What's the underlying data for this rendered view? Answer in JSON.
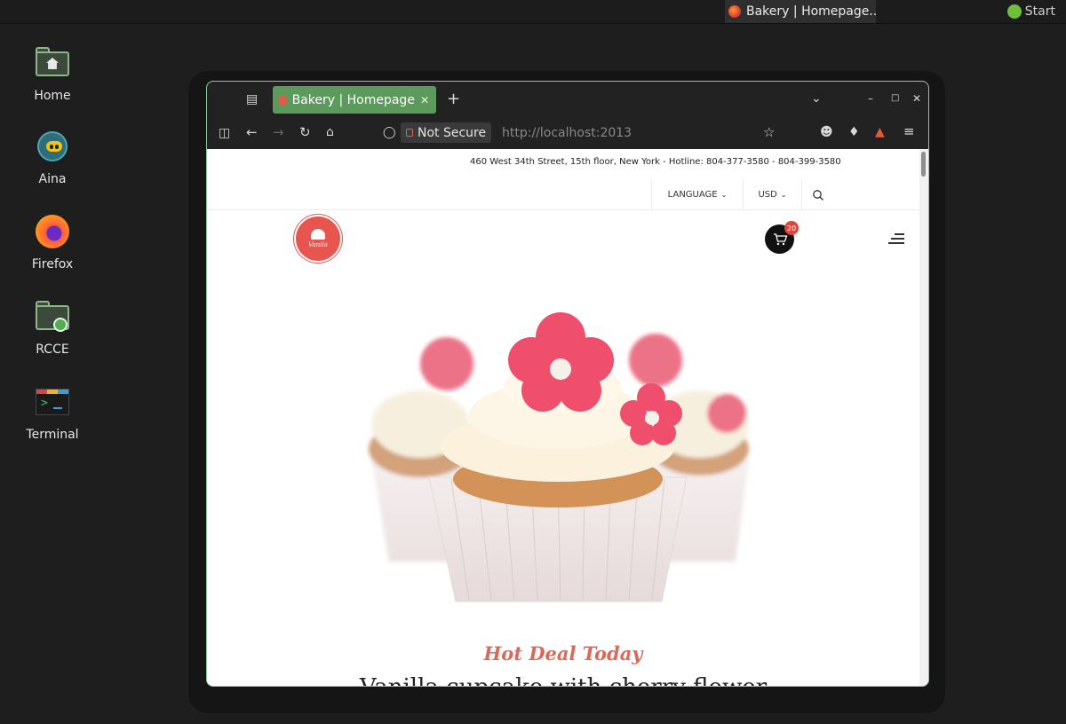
{
  "panel": {
    "task_title": "Bakery | Homepage...",
    "start_label": "Start"
  },
  "desktop": {
    "icons": [
      {
        "label": "Home",
        "icon": "home-folder-icon"
      },
      {
        "label": "Aina",
        "icon": "aina-icon"
      },
      {
        "label": "Firefox",
        "icon": "firefox-icon"
      },
      {
        "label": "RCCE",
        "icon": "rcce-folder-icon"
      },
      {
        "label": "Terminal",
        "icon": "terminal-icon"
      }
    ]
  },
  "browser": {
    "tab_title": "Bakery | Homepage",
    "security_label": "Not Secure",
    "url": "http://localhost:2013"
  },
  "site": {
    "top_info": "460 West 34th Street, 15th floor, New York - Hotline: 804-377-3580 - 804-399-3580",
    "language_label": "LANGUAGE",
    "currency_label": "USD",
    "cart_count": "20",
    "logo_text": "Vanila",
    "hot_deal": "Hot Deal Today",
    "headline": "Vanilla cupcake with cherry flower"
  },
  "colors": {
    "accent_tab": "#5c9a5c",
    "brand_red": "#e8554e",
    "hot_deal": "#d96a5a"
  }
}
